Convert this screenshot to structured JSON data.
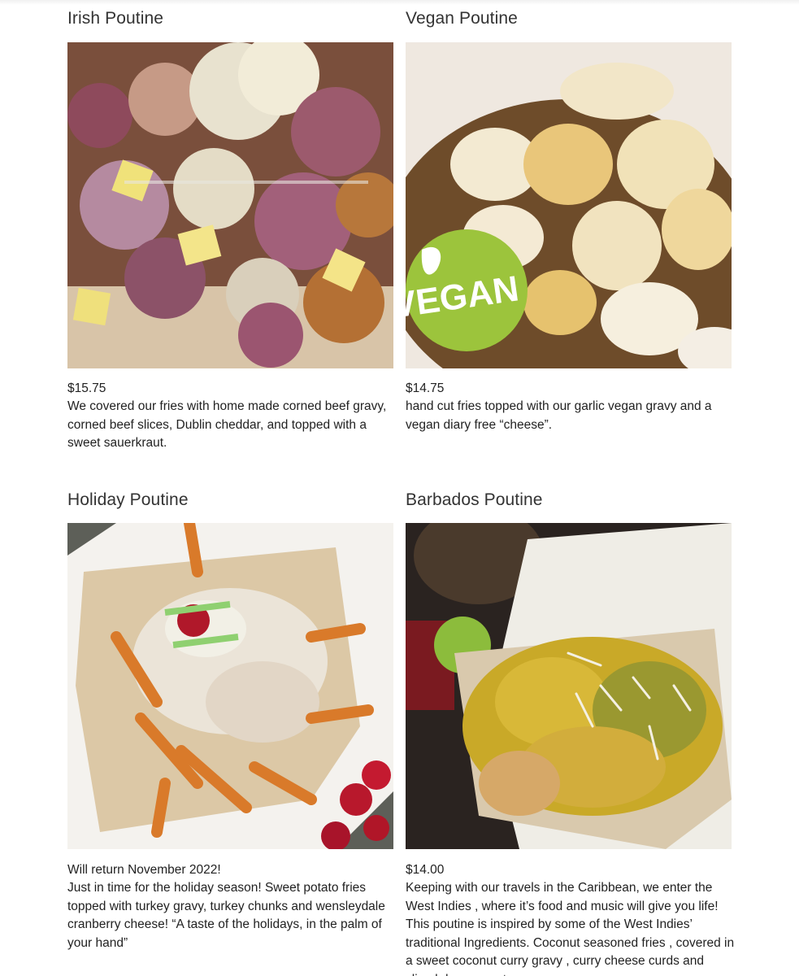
{
  "items": [
    {
      "title": "Irish Poutine",
      "price": "$15.75",
      "description": "We covered our fries with home made corned beef gravy, corned beef slices, Dublin cheddar, and topped with a sweet sauerkraut."
    },
    {
      "title": "Vegan Poutine",
      "price": "$14.75",
      "description": "hand cut fries topped with our garlic vegan gravy and a vegan diary free “cheese”.",
      "badge": "VEGAN"
    },
    {
      "title": "Holiday Poutine",
      "price": "Will return November 2022!",
      "description": "Just in time for the holiday season! Sweet potato fries topped with turkey gravy, turkey chunks and wensleydale cranberry cheese! “A taste of the holidays, in the palm of your hand”"
    },
    {
      "title": "Barbados Poutine",
      "price": "$14.00",
      "description": "Keeping with our travels in the Caribbean, we enter the West Indies , where it’s food and music will give you life! This poutine is inspired by some of the West Indies’ traditional Ingredients. Coconut seasoned fries , covered in a sweet coconut curry gravy , curry cheese curds and sliced dry coconut."
    }
  ]
}
